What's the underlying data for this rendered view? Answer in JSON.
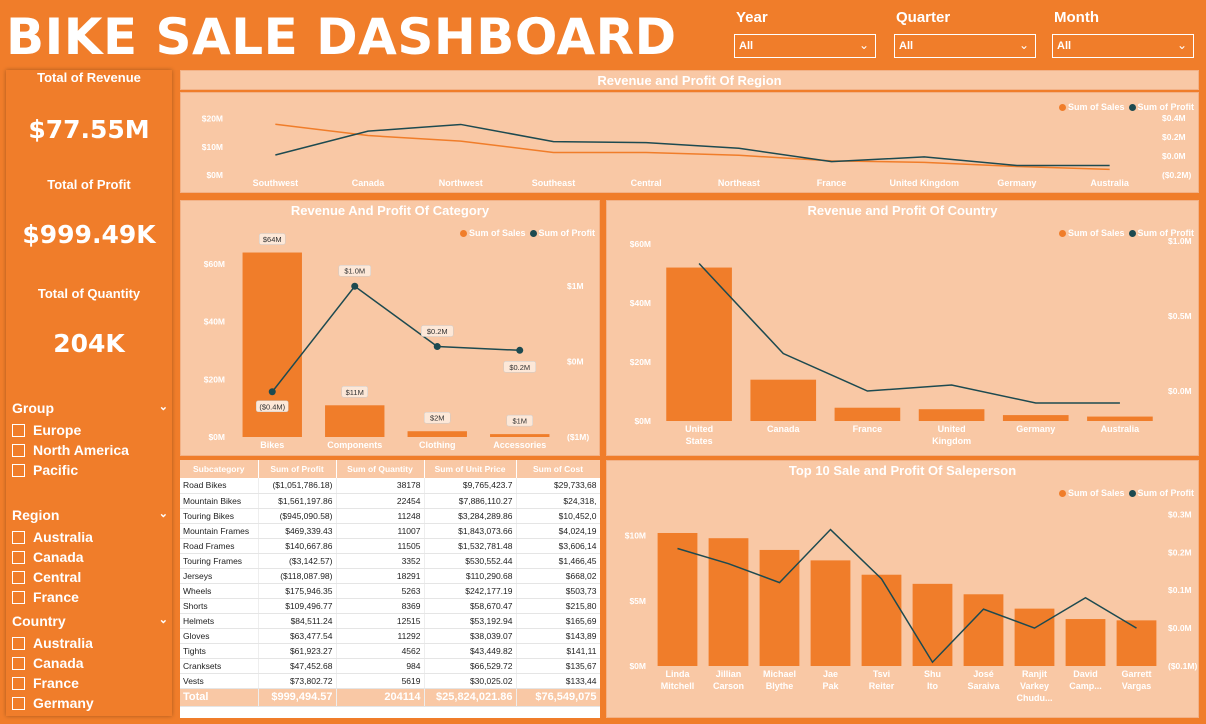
{
  "header": {
    "title": "BIKE SALE DASHBOARD"
  },
  "slicers": [
    {
      "label": "Year",
      "value": "All"
    },
    {
      "label": "Quarter",
      "value": "All"
    },
    {
      "label": "Month",
      "value": "All"
    }
  ],
  "kpis": [
    {
      "label": "Total of Revenue",
      "value": "$77.55M"
    },
    {
      "label": "Total of Profit",
      "value": "$999.49K"
    },
    {
      "label": "Total of Quantity",
      "value": "204K"
    }
  ],
  "filters": {
    "group": {
      "label": "Group",
      "items": [
        "Europe",
        "North America",
        "Pacific"
      ]
    },
    "region": {
      "label": "Region",
      "items": [
        "Australia",
        "Canada",
        "Central",
        "France"
      ]
    },
    "country": {
      "label": "Country",
      "items": [
        "Australia",
        "Canada",
        "France",
        "Germany"
      ]
    }
  },
  "legend": {
    "sales": "Sum of Sales",
    "profit": "Sum of Profit"
  },
  "colors": {
    "orange": "#f07d2a",
    "panel": "#f9c8a5",
    "profit_line": "#1d4a50"
  },
  "chart_data": [
    {
      "type": "line",
      "title": "Revenue and Profit Of Region",
      "categories": [
        "Southwest",
        "Canada",
        "Northwest",
        "Southeast",
        "Central",
        "Northeast",
        "France",
        "United Kingdom",
        "Germany",
        "Australia"
      ],
      "series": [
        {
          "name": "Sum of Sales",
          "axis": "left",
          "values": [
            18,
            14,
            12,
            8,
            8,
            7,
            5,
            4.5,
            3,
            2
          ]
        },
        {
          "name": "Sum of Profit",
          "axis": "right",
          "values": [
            0.01,
            0.26,
            0.33,
            0.15,
            0.14,
            0.08,
            -0.06,
            -0.01,
            -0.1,
            -0.1
          ]
        }
      ],
      "left_ticks": [
        "$20M",
        "$10M",
        "$0M"
      ],
      "right_ticks": [
        "$0.4M",
        "$0.2M",
        "$0.0M",
        "($0.2M)"
      ],
      "ylim_left": [
        0,
        22
      ],
      "ylim_right": [
        -0.2,
        0.45
      ]
    },
    {
      "type": "bar",
      "title": "Revenue And Profit Of Category",
      "categories": [
        "Bikes",
        "Components",
        "Clothing",
        "Accessories"
      ],
      "series": [
        {
          "name": "Sum of Sales",
          "axis": "left",
          "values": [
            64,
            11,
            2,
            1
          ],
          "labels": [
            "$64M",
            "$11M",
            "$2M",
            "$1M"
          ]
        },
        {
          "name": "Sum of Profit",
          "axis": "right",
          "values": [
            -0.4,
            1.0,
            0.2,
            0.15
          ],
          "labels": [
            "($0.4M)",
            "$1.0M",
            "$0.2M",
            "$0.2M"
          ]
        }
      ],
      "left_ticks": [
        "$60M",
        "$40M",
        "$20M",
        "$0M"
      ],
      "right_ticks": [
        "$1M",
        "$0M",
        "($1M)"
      ],
      "ylim_left": [
        0,
        68
      ],
      "ylim_right": [
        -1,
        1.6
      ]
    },
    {
      "type": "bar",
      "title": "Revenue and Profit Of Country",
      "categories": [
        "United States",
        "Canada",
        "France",
        "United Kingdom",
        "Germany",
        "Australia"
      ],
      "series": [
        {
          "name": "Sum of Sales",
          "axis": "left",
          "values": [
            52,
            14,
            4.5,
            4,
            2,
            1.5
          ]
        },
        {
          "name": "Sum of Profit",
          "axis": "right",
          "values": [
            0.85,
            0.25,
            0.0,
            0.04,
            -0.08,
            -0.08
          ]
        }
      ],
      "left_ticks": [
        "$60M",
        "$40M",
        "$20M",
        "$0M"
      ],
      "right_ticks": [
        "$1.0M",
        "$0.5M",
        "$0.0M"
      ],
      "ylim_left": [
        0,
        61
      ],
      "ylim_right": [
        -0.2,
        1.0
      ]
    },
    {
      "type": "bar",
      "title": "Top 10 Sale and Profit Of Saleperson",
      "categories": [
        "Linda Mitchell",
        "Jillian Carson",
        "Michael Blythe",
        "Jae Pak",
        "Tsvi Reiter",
        "Shu Ito",
        "José Saraiva",
        "Ranjit Varkey Chudu...",
        "David Camp...",
        "Garrett Vargas"
      ],
      "series": [
        {
          "name": "Sum of Sales",
          "axis": "left",
          "values": [
            10.2,
            9.8,
            8.9,
            8.1,
            7.0,
            6.3,
            5.5,
            4.4,
            3.6,
            3.5
          ]
        },
        {
          "name": "Sum of Profit",
          "axis": "right",
          "values": [
            0.21,
            0.17,
            0.12,
            0.26,
            0.13,
            -0.09,
            0.05,
            0.0,
            0.08,
            0.0
          ]
        }
      ],
      "left_ticks": [
        "$10M",
        "$5M",
        "$0M"
      ],
      "right_ticks": [
        "$0.3M",
        "$0.2M",
        "$0.1M",
        "$0.0M",
        "($0.1M)"
      ],
      "ylim_left": [
        0,
        12.5
      ],
      "ylim_right": [
        -0.1,
        0.33
      ]
    }
  ],
  "table": {
    "headers": [
      "Subcategory",
      "Sum of Profit",
      "Sum of Quantity",
      "Sum of Unit Price",
      "Sum of Cost"
    ],
    "rows": [
      [
        "Road Bikes",
        "($1,051,786.18)",
        "38178",
        "$9,765,423.7",
        "$29,733,68"
      ],
      [
        "Mountain Bikes",
        "$1,561,197.86",
        "22454",
        "$7,886,110.27",
        "$24,318,"
      ],
      [
        "Touring Bikes",
        "($945,090.58)",
        "11248",
        "$3,284,289.86",
        "$10,452,0"
      ],
      [
        "Mountain Frames",
        "$469,339.43",
        "11007",
        "$1,843,073.66",
        "$4,024,19"
      ],
      [
        "Road Frames",
        "$140,667.86",
        "11505",
        "$1,532,781.48",
        "$3,606,14"
      ],
      [
        "Touring Frames",
        "($3,142.57)",
        "3352",
        "$530,552.44",
        "$1,466,45"
      ],
      [
        "Jerseys",
        "($118,087.98)",
        "18291",
        "$110,290.68",
        "$668,02"
      ],
      [
        "Wheels",
        "$175,946.35",
        "5263",
        "$242,177.19",
        "$503,73"
      ],
      [
        "Shorts",
        "$109,496.77",
        "8369",
        "$58,670.47",
        "$215,80"
      ],
      [
        "Helmets",
        "$84,511.24",
        "12515",
        "$53,192.94",
        "$165,69"
      ],
      [
        "Gloves",
        "$63,477.54",
        "11292",
        "$38,039.07",
        "$143,89"
      ],
      [
        "Tights",
        "$61,923.27",
        "4562",
        "$43,449.82",
        "$141,11"
      ],
      [
        "Cranksets",
        "$47,452.68",
        "984",
        "$66,529.72",
        "$135,67"
      ],
      [
        "Vests",
        "$73,802.72",
        "5619",
        "$30,025.02",
        "$133,44"
      ]
    ],
    "total": [
      "Total",
      "$999,494.57",
      "204114",
      "$25,824,021.86",
      "$76,549,075"
    ]
  }
}
